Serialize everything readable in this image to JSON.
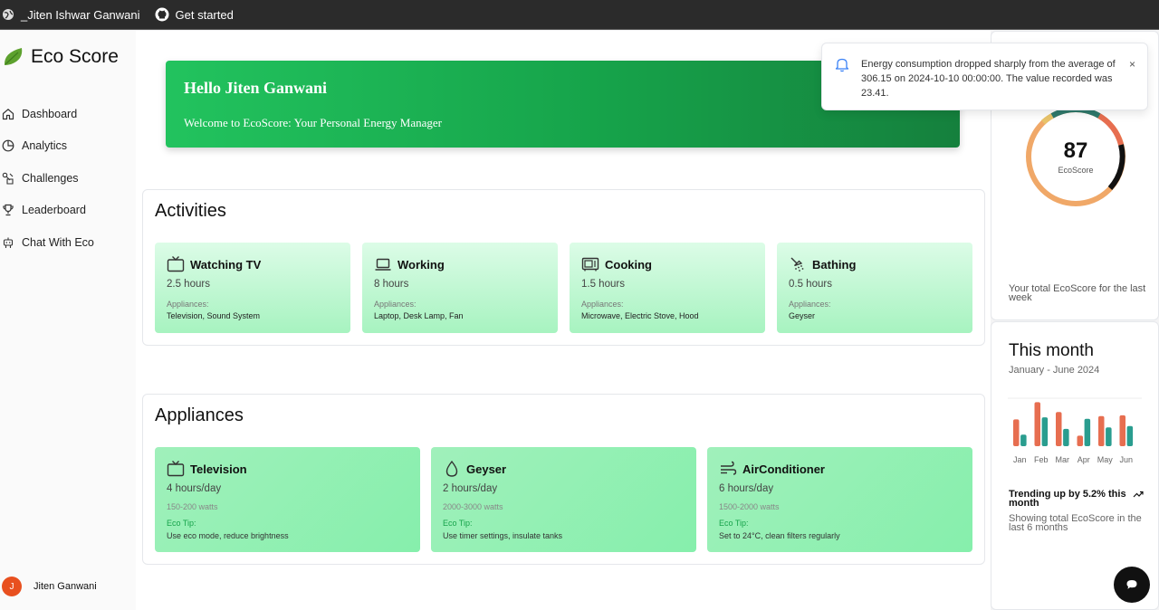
{
  "topbar": {
    "profile_label": "_Jiten Ishwar Ganwani",
    "github_label": "Get started"
  },
  "sidebar": {
    "brand": "Eco Score",
    "items": [
      {
        "label": "Dashboard",
        "icon": "home-icon"
      },
      {
        "label": "Analytics",
        "icon": "pie-chart-icon"
      },
      {
        "label": "Challenges",
        "icon": "puzzle-icon"
      },
      {
        "label": "Leaderboard",
        "icon": "trophy-icon"
      },
      {
        "label": "Chat With Eco",
        "icon": "robot-icon"
      }
    ],
    "user": {
      "initial": "J",
      "name": "Jiten Ganwani"
    }
  },
  "hero": {
    "title": "Hello Jiten Ganwani",
    "subtitle": "Welcome to EcoScore: Your Personal Energy Manager"
  },
  "activities": {
    "title": "Activities",
    "appliances_label": "Appliances:",
    "items": [
      {
        "name": "Watching TV",
        "hours": "2.5 hours",
        "appliances": "Television, Sound System",
        "icon": "tv-icon"
      },
      {
        "name": "Working",
        "hours": "8 hours",
        "appliances": "Laptop, Desk Lamp, Fan",
        "icon": "laptop-icon"
      },
      {
        "name": "Cooking",
        "hours": "1.5 hours",
        "appliances": "Microwave, Electric Stove, Hood",
        "icon": "microwave-icon"
      },
      {
        "name": "Bathing",
        "hours": "0.5 hours",
        "appliances": "Geyser",
        "icon": "shower-icon"
      }
    ]
  },
  "appliances": {
    "title": "Appliances",
    "tip_label": "Eco Tip:",
    "items": [
      {
        "name": "Television",
        "usage": "4 hours/day",
        "watts": "150-200 watts",
        "tip": "Use eco mode, reduce brightness",
        "icon": "tv-icon"
      },
      {
        "name": "Geyser",
        "usage": "2 hours/day",
        "watts": "2000-3000 watts",
        "tip": "Use timer settings, insulate tanks",
        "icon": "droplet-icon"
      },
      {
        "name": "AirConditioner",
        "usage": "6 hours/day",
        "watts": "1500-2000 watts",
        "tip": "Set to 24°C, clean filters regularly",
        "icon": "wind-icon"
      }
    ]
  },
  "ecoscore": {
    "value": "87",
    "label": "EcoScore",
    "description": "Your total EcoScore for the last week"
  },
  "month": {
    "title": "This month",
    "range": "January - June 2024",
    "trend": "Trending up by 5.2% this month",
    "trend_sub": "Showing total EcoScore in the last 6 months"
  },
  "toast": {
    "message": "Energy consumption dropped sharply from the average of 306.15 on 2024-10-10 00:00:00. The value recorded was 23.41.",
    "close": "×"
  },
  "chart_data": {
    "type": "bar",
    "categories": [
      "Jan",
      "Feb",
      "Mar",
      "Apr",
      "May",
      "Jun"
    ],
    "series": [
      {
        "color": "#e76e50",
        "values": [
          186,
          305,
          237,
          73,
          209,
          214
        ]
      },
      {
        "color": "#2a9d8f",
        "values": [
          80,
          200,
          120,
          190,
          130,
          140
        ]
      }
    ],
    "ylim": [
      0,
      320
    ]
  }
}
